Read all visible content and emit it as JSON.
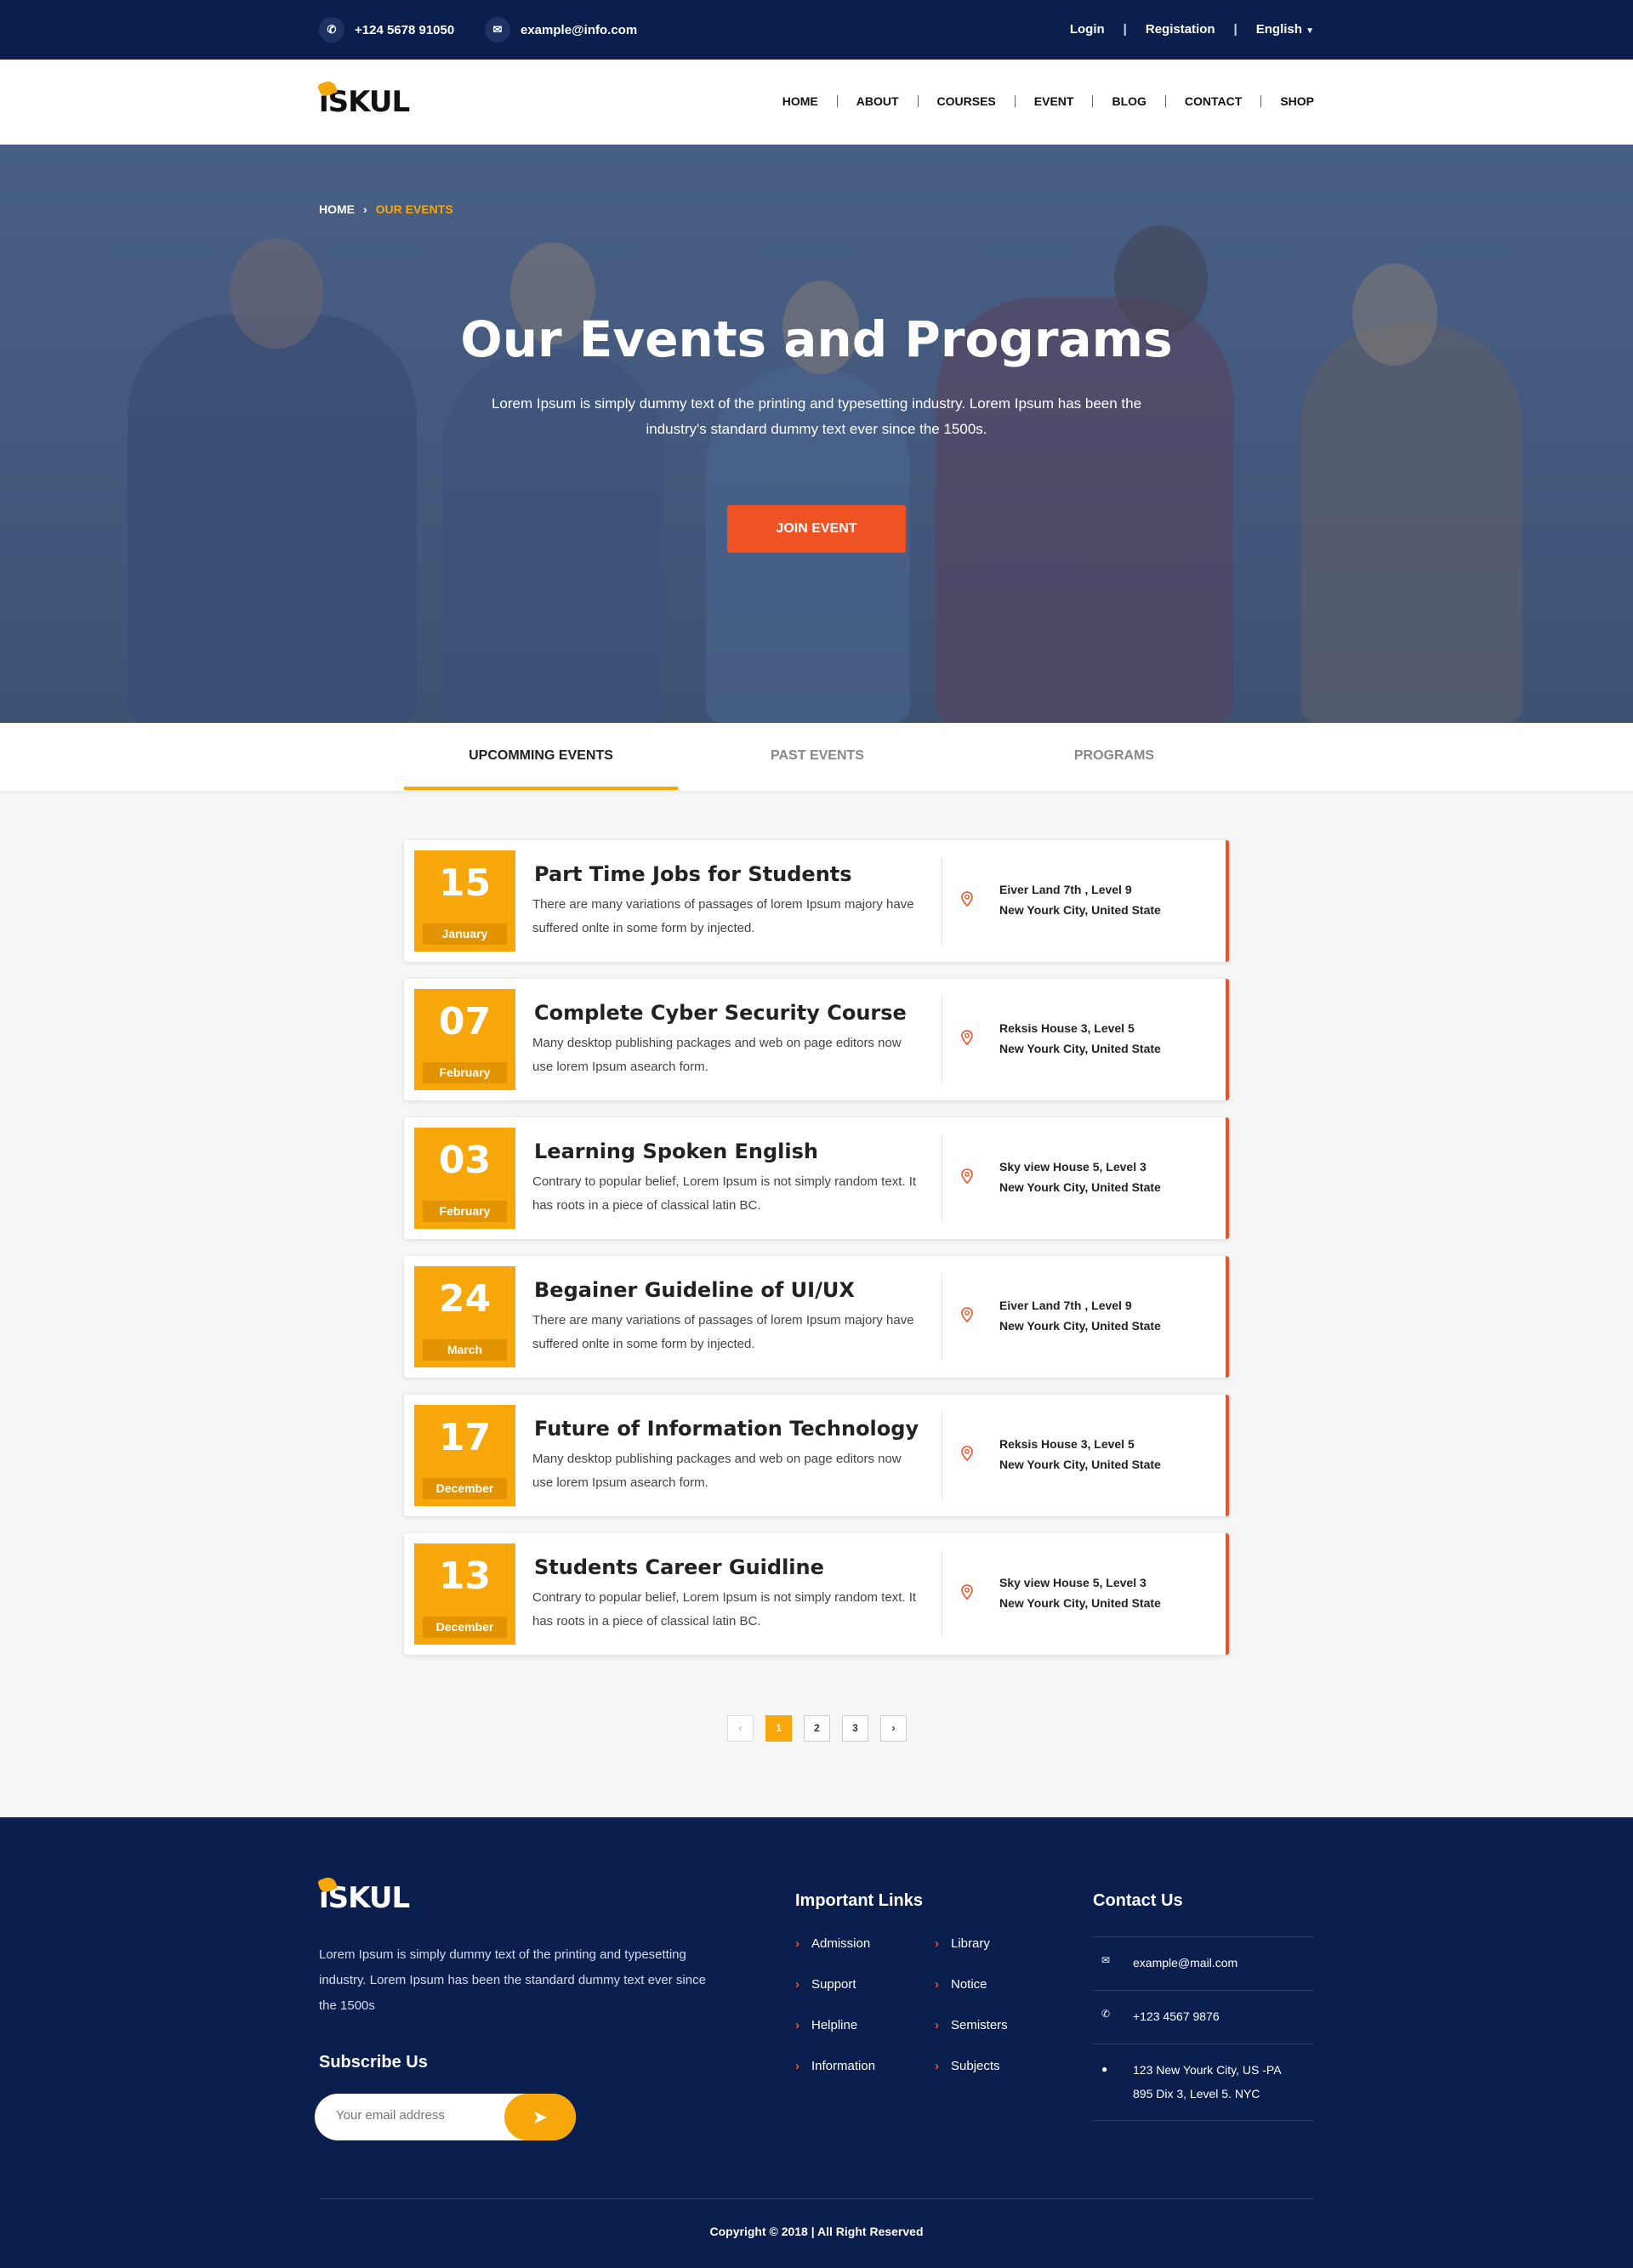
{
  "topbar": {
    "phone": "+124 5678 91050",
    "email": "example@info.com",
    "login": "Login",
    "register": "Registation",
    "language": "English",
    "separator": "|"
  },
  "brand": {
    "name": "iSKUL"
  },
  "nav": {
    "items": [
      "HOME",
      "ABOUT",
      "COURSES",
      "EVENT",
      "BLOG",
      "CONTACT",
      "SHOP"
    ]
  },
  "hero": {
    "breadcrumb_home": "HOME",
    "breadcrumb_current": "OUR EVENTS",
    "title": "Our Events and Programs",
    "subtitle": "Lorem Ipsum is simply dummy text of the printing and typesetting industry. Lorem Ipsum has been the industry's standard dummy text ever since the 1500s.",
    "cta": "JOIN EVENT"
  },
  "tabs": [
    "UPCOMMING EVENTS",
    "PAST EVENTS",
    "PROGRAMS"
  ],
  "events": [
    {
      "day": "15",
      "month": "January",
      "title": "Part Time Jobs for Students",
      "desc": "There are many variations of passages of lorem Ipsum majory have suffered onlte in some form by injected.",
      "loc1": "Eiver Land 7th , Level 9",
      "loc2": "New Yourk City, United State"
    },
    {
      "day": "07",
      "month": "February",
      "title": "Complete Cyber Security Course",
      "desc": "Many desktop publishing packages and web on page editors now use lorem Ipsum asearch form.",
      "loc1": "Reksis House 3, Level 5",
      "loc2": "New Yourk City, United State"
    },
    {
      "day": "03",
      "month": "February",
      "title": "Learning Spoken English",
      "desc": "Contrary to popular belief, Lorem Ipsum is not simply random text. It has roots in a piece of classical latin BC.",
      "loc1": "Sky view House 5, Level 3",
      "loc2": "New Yourk City, United State"
    },
    {
      "day": "24",
      "month": "March",
      "title": "Begainer Guideline of UI/UX",
      "desc": "There are many variations of passages of lorem Ipsum majory have suffered onlte in some form by injected.",
      "loc1": "Eiver Land 7th , Level 9",
      "loc2": "New Yourk City, United State"
    },
    {
      "day": "17",
      "month": "December",
      "title": "Future of Information Technology",
      "desc": "Many desktop publishing packages and web on page editors now use lorem Ipsum asearch form.",
      "loc1": "Reksis House 3, Level 5",
      "loc2": "New Yourk City, United State"
    },
    {
      "day": "13",
      "month": "December",
      "title": "Students Career Guidline",
      "desc": "Contrary to popular belief, Lorem Ipsum is not simply random text. It has roots in a piece of classical latin BC.",
      "loc1": "Sky view House 5, Level 3",
      "loc2": "New Yourk City, United State"
    }
  ],
  "pagination": {
    "prev": "‹",
    "pages": [
      "1",
      "2",
      "3"
    ],
    "next": "›",
    "current": "1"
  },
  "footer": {
    "about": "Lorem Ipsum is simply dummy text of the printing and typesetting industry. Lorem Ipsum has been the standard dummy text ever since the 1500s",
    "subscribe_title": "Subscribe Us",
    "subscribe_placeholder": "Your email address",
    "links_title": "Important Links",
    "links_col1": [
      "Admission",
      "Support",
      "Helpline",
      "Information"
    ],
    "links_col2": [
      "Library",
      "Notice",
      "Semisters",
      "Subjects"
    ],
    "contact_title": "Contact Us",
    "contact_email": "example@mail.com",
    "contact_phone": "+123 4567 9876",
    "contact_address": "123 New Yourk City, US -PA 895 Dix 3, Level 5. NYC",
    "copyright": "Copyright © 2018 |  All Right Reserved"
  },
  "colors": {
    "navy": "#0b1f4f",
    "accent": "#f7a70a",
    "orange": "#ef5324"
  }
}
